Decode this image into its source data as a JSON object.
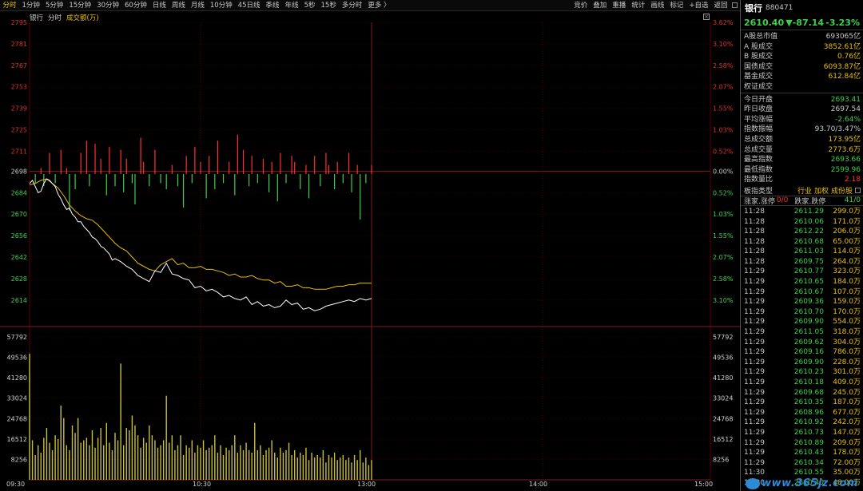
{
  "toolbar": {
    "periods": [
      "分时",
      "1分钟",
      "5分钟",
      "15分钟",
      "30分钟",
      "60分钟",
      "日线",
      "周线",
      "月线",
      "10分钟",
      "45日线",
      "季线",
      "年线",
      "5秒",
      "15秒",
      "多分时",
      "更多 〉"
    ],
    "active_index": 0,
    "right_items": [
      "竞价",
      "叠加",
      "重播",
      "统计",
      "画线",
      "标记",
      "+自选",
      "返回"
    ]
  },
  "subheader": {
    "name": "银行",
    "mode": "分时",
    "series": "成交额(万)"
  },
  "colors": {
    "up": "#ff3030",
    "down": "#3dd14a",
    "index_line": "#ffffff",
    "avg_line": "#e8c000",
    "volume_bar": "#c8c03a"
  },
  "chart_data": [
    {
      "type": "line",
      "name": "price",
      "yticks_left": [
        "2795",
        "2781",
        "2767",
        "2753",
        "2739",
        "2725",
        "2711",
        "2698",
        "2684",
        "2670",
        "2656",
        "2642",
        "2628",
        "2614"
      ],
      "yticks_right": [
        "3.62%",
        "3.10%",
        "2.58%",
        "2.07%",
        "1.55%",
        "1.03%",
        "0.52%",
        "0.00%",
        "0.52%",
        "1.03%",
        "1.55%",
        "2.07%",
        "2.58%",
        "3.10%"
      ],
      "right_tick_colors": [
        "up",
        "up",
        "up",
        "up",
        "up",
        "up",
        "up",
        "flat",
        "down",
        "down",
        "down",
        "down",
        "down",
        "down"
      ],
      "ylim": [
        2604,
        2795
      ],
      "prev_close": 2697.54,
      "time_labels": [
        "09:30",
        "10:30",
        "13:00",
        "14:00",
        "15:00"
      ],
      "series": [
        {
          "name": "index",
          "x": [
            0,
            1,
            2,
            3,
            4,
            5,
            6,
            7,
            8,
            9,
            10,
            11,
            12,
            13,
            14,
            15,
            16,
            17,
            18,
            19,
            20,
            21,
            22,
            23,
            24,
            25,
            26,
            27,
            28,
            29,
            30,
            32,
            34,
            36,
            38,
            40,
            42,
            44,
            46,
            48,
            50,
            52,
            54,
            56,
            58,
            60,
            62,
            64,
            66,
            68,
            70,
            72,
            74,
            76,
            78,
            80,
            82,
            84,
            86,
            88,
            90,
            92,
            94,
            96,
            98,
            100,
            102,
            104,
            106,
            108,
            110,
            112,
            114,
            116,
            118,
            120
          ],
          "values": [
            2690,
            2692,
            2688,
            2684,
            2685,
            2690,
            2693,
            2692,
            2690,
            2688,
            2683,
            2680,
            2676,
            2673,
            2674,
            2670,
            2668,
            2665,
            2665,
            2662,
            2660,
            2658,
            2655,
            2654,
            2652,
            2649,
            2648,
            2646,
            2644,
            2640,
            2641,
            2639,
            2636,
            2634,
            2630,
            2628,
            2626,
            2633,
            2632,
            2638,
            2631,
            2630,
            2628,
            2627,
            2622,
            2623,
            2620,
            2621,
            2619,
            2616,
            2617,
            2615,
            2614,
            2616,
            2611,
            2613,
            2610,
            2611,
            2609,
            2610,
            2614,
            2611,
            2612,
            2608,
            2609,
            2607,
            2608,
            2610,
            2611,
            2612,
            2613,
            2614,
            2613,
            2615,
            2614,
            2615
          ]
        },
        {
          "name": "average",
          "x": [
            0,
            2,
            4,
            6,
            8,
            10,
            12,
            14,
            16,
            18,
            20,
            22,
            24,
            26,
            28,
            30,
            32,
            34,
            36,
            38,
            40,
            42,
            44,
            46,
            48,
            50,
            52,
            54,
            56,
            58,
            60,
            62,
            64,
            66,
            68,
            70,
            72,
            74,
            76,
            78,
            80,
            82,
            84,
            86,
            88,
            90,
            92,
            94,
            96,
            98,
            100,
            102,
            104,
            106,
            108,
            110,
            112,
            114,
            116,
            118,
            120
          ],
          "values": [
            2689,
            2690,
            2692,
            2693,
            2690,
            2687,
            2682,
            2676,
            2672,
            2669,
            2667,
            2666,
            2663,
            2659,
            2655,
            2651,
            2648,
            2646,
            2642,
            2638,
            2636,
            2634,
            2633,
            2637,
            2639,
            2641,
            2637,
            2638,
            2635,
            2635,
            2636,
            2634,
            2634,
            2633,
            2632,
            2630,
            2631,
            2629,
            2629,
            2630,
            2628,
            2627,
            2627,
            2625,
            2626,
            2623,
            2623,
            2624,
            2622,
            2622,
            2621,
            2621,
            2621,
            2622,
            2623,
            2623,
            2624,
            2624,
            2625,
            2625,
            2625
          ]
        }
      ]
    },
    {
      "type": "bar",
      "name": "breadth",
      "x": [
        2,
        4,
        5,
        7,
        9,
        11,
        13,
        14,
        16,
        18,
        20,
        21,
        23,
        25,
        27,
        28,
        30,
        32,
        33,
        34,
        36,
        37,
        39,
        40,
        42,
        44,
        46,
        48,
        50,
        52,
        54,
        55,
        57,
        58,
        60,
        62,
        63,
        65,
        66,
        68,
        70,
        72,
        73,
        75,
        77,
        78,
        80,
        82,
        84,
        85,
        87,
        88,
        90,
        92,
        93,
        95,
        97,
        98,
        100,
        102,
        104,
        105,
        107,
        108,
        110,
        112,
        113,
        115,
        116,
        118,
        120
      ],
      "values": [
        -3,
        2,
        -4,
        7,
        -3,
        8,
        2,
        -12,
        -5,
        7,
        11,
        -4,
        10,
        5,
        -7,
        9,
        -4,
        8,
        -6,
        5,
        -3,
        -10,
        12,
        4,
        -4,
        8,
        -3,
        -5,
        3,
        -4,
        -11,
        6,
        -3,
        9,
        4,
        -8,
        6,
        -5,
        11,
        -3,
        4,
        -7,
        13,
        8,
        -4,
        6,
        -3,
        5,
        -6,
        4,
        -9,
        7,
        -3,
        6,
        4,
        -5,
        3,
        -8,
        6,
        -4,
        7,
        3,
        -5,
        4,
        -3,
        7,
        -6,
        3,
        -15,
        -3,
        3
      ]
    },
    {
      "type": "bar",
      "name": "turnover",
      "yticks": [
        "57792",
        "49536",
        "41280",
        "33024",
        "24768",
        "16512",
        "8256"
      ],
      "ylim": [
        0,
        57792
      ],
      "x": [
        0,
        1,
        2,
        3,
        4,
        5,
        6,
        7,
        8,
        9,
        10,
        11,
        12,
        13,
        14,
        15,
        16,
        17,
        18,
        19,
        20,
        21,
        22,
        23,
        24,
        25,
        26,
        27,
        28,
        29,
        30,
        31,
        32,
        33,
        34,
        35,
        36,
        37,
        38,
        39,
        40,
        41,
        42,
        43,
        44,
        45,
        46,
        47,
        48,
        49,
        50,
        51,
        52,
        53,
        54,
        55,
        56,
        57,
        58,
        59,
        60,
        61,
        62,
        63,
        64,
        65,
        66,
        67,
        68,
        69,
        70,
        71,
        72,
        73,
        74,
        75,
        76,
        77,
        78,
        79,
        80,
        81,
        82,
        83,
        84,
        85,
        86,
        87,
        88,
        89,
        90,
        91,
        92,
        93,
        94,
        95,
        96,
        97,
        98,
        99,
        100,
        101,
        102,
        103,
        104,
        105,
        106,
        107,
        108,
        109,
        110,
        111,
        112,
        113,
        114,
        115,
        116,
        117,
        118,
        119,
        120
      ],
      "values": [
        51000,
        16000,
        10000,
        14000,
        11000,
        17000,
        21000,
        15000,
        12000,
        18000,
        16500,
        30000,
        25000,
        14000,
        12000,
        22000,
        19000,
        25000,
        15000,
        16000,
        17000,
        14000,
        20000,
        13000,
        17000,
        21000,
        14000,
        23000,
        15000,
        12000,
        19000,
        16000,
        47000,
        14000,
        21000,
        20000,
        26000,
        22000,
        18000,
        13000,
        17000,
        15000,
        22000,
        18000,
        16000,
        13000,
        14000,
        16000,
        34000,
        15000,
        18000,
        12000,
        14000,
        18000,
        10000,
        14000,
        13000,
        16000,
        11000,
        14000,
        13000,
        16000,
        12000,
        13000,
        14000,
        18000,
        11000,
        14000,
        10000,
        13000,
        12000,
        14000,
        18000,
        11000,
        14000,
        12000,
        15000,
        12000,
        11000,
        23000,
        12000,
        14000,
        10000,
        12000,
        13000,
        16000,
        11000,
        9000,
        13000,
        11000,
        12000,
        15000,
        10000,
        12000,
        9000,
        11000,
        10000,
        13000,
        8000,
        11000,
        9000,
        10000,
        9000,
        12000,
        7000,
        10000,
        9000,
        11000,
        8000,
        9000,
        10000,
        8000,
        9000,
        7000,
        10000,
        8000,
        12000,
        7000,
        9000,
        6000,
        8000
      ]
    }
  ],
  "panel": {
    "name": "银行",
    "code": "880471",
    "price": "2610.40",
    "change": "▼-87.14",
    "change_pct": "-3.23%",
    "stats1": [
      {
        "k": "A股总市值",
        "v": "693065亿",
        "c": ""
      },
      {
        "k": "A 股成交",
        "v": "3852.61亿",
        "c": "yellow"
      },
      {
        "k": "B 股成交",
        "v": "0.76亿",
        "c": "yellow"
      },
      {
        "k": "国债成交",
        "v": "6093.87亿",
        "c": "yellow"
      },
      {
        "k": "基金成交",
        "v": "612.84亿",
        "c": "yellow"
      },
      {
        "k": "权证成交",
        "v": "",
        "c": ""
      }
    ],
    "stats2": [
      {
        "k": "今日开盘",
        "v": "2693.41",
        "c": "green"
      },
      {
        "k": "昨日收盘",
        "v": "2697.54",
        "c": ""
      },
      {
        "k": "平均涨幅",
        "v": "-2.64%",
        "c": "green"
      },
      {
        "k": "指数振幅",
        "v": "93.70/3.47%",
        "c": ""
      },
      {
        "k": "总成交额",
        "v": "173.95亿",
        "c": "yellow"
      },
      {
        "k": "总成交量",
        "v": "2773.6万",
        "c": "yellow"
      },
      {
        "k": "最高指数",
        "v": "2693.66",
        "c": "green"
      },
      {
        "k": "最低指数",
        "v": "2599.96",
        "c": "green"
      },
      {
        "k": "指数量比",
        "v": "2.18",
        "c": "red"
      }
    ],
    "board": {
      "label": "板指类型",
      "links": [
        "行业",
        "加权",
        "成份股"
      ]
    },
    "advance": {
      "label1": "涨家.涨停",
      "value1": "0/0",
      "label2": "跌家.跌停",
      "value2": "41/0"
    },
    "ticks": [
      {
        "t": "11:28",
        "p": "2611.29",
        "v": "299.0万"
      },
      {
        "t": "11:28",
        "p": "2610.06",
        "v": "171.0万"
      },
      {
        "t": "11:28",
        "p": "2612.22",
        "v": "206.0万"
      },
      {
        "t": "11:28",
        "p": "2610.68",
        "v": "65.00万"
      },
      {
        "t": "11:28",
        "p": "2611.03",
        "v": "114.0万"
      },
      {
        "t": "11:28",
        "p": "2609.75",
        "v": "264.0万"
      },
      {
        "t": "11:29",
        "p": "2610.77",
        "v": "323.0万"
      },
      {
        "t": "11:29",
        "p": "2610.65",
        "v": "184.0万"
      },
      {
        "t": "11:29",
        "p": "2610.67",
        "v": "107.0万"
      },
      {
        "t": "11:29",
        "p": "2609.36",
        "v": "159.0万"
      },
      {
        "t": "11:29",
        "p": "2610.70",
        "v": "170.0万"
      },
      {
        "t": "11:29",
        "p": "2609.90",
        "v": "554.0万"
      },
      {
        "t": "11:29",
        "p": "2611.05",
        "v": "318.0万"
      },
      {
        "t": "11:29",
        "p": "2609.62",
        "v": "304.0万"
      },
      {
        "t": "11:29",
        "p": "2609.16",
        "v": "786.0万"
      },
      {
        "t": "11:29",
        "p": "2609.90",
        "v": "228.0万"
      },
      {
        "t": "11:29",
        "p": "2610.23",
        "v": "301.0万"
      },
      {
        "t": "11:29",
        "p": "2610.18",
        "v": "409.0万"
      },
      {
        "t": "11:29",
        "p": "2609.68",
        "v": "245.0万"
      },
      {
        "t": "11:29",
        "p": "2610.35",
        "v": "187.0万"
      },
      {
        "t": "11:29",
        "p": "2608.96",
        "v": "677.0万"
      },
      {
        "t": "11:29",
        "p": "2610.92",
        "v": "242.0万"
      },
      {
        "t": "11:29",
        "p": "2610.73",
        "v": "147.0万"
      },
      {
        "t": "11:29",
        "p": "2610.89",
        "v": "209.0万"
      },
      {
        "t": "11:29",
        "p": "2610.43",
        "v": "178.0万"
      },
      {
        "t": "11:29",
        "p": "2610.34",
        "v": "72.00万"
      },
      {
        "t": "11:30",
        "p": "2610.55",
        "v": "35.00万"
      },
      {
        "t": "11:30",
        "p": "2610.40",
        "v": "48.00万"
      }
    ]
  },
  "watermark": {
    "text": "www.365jz.com"
  }
}
